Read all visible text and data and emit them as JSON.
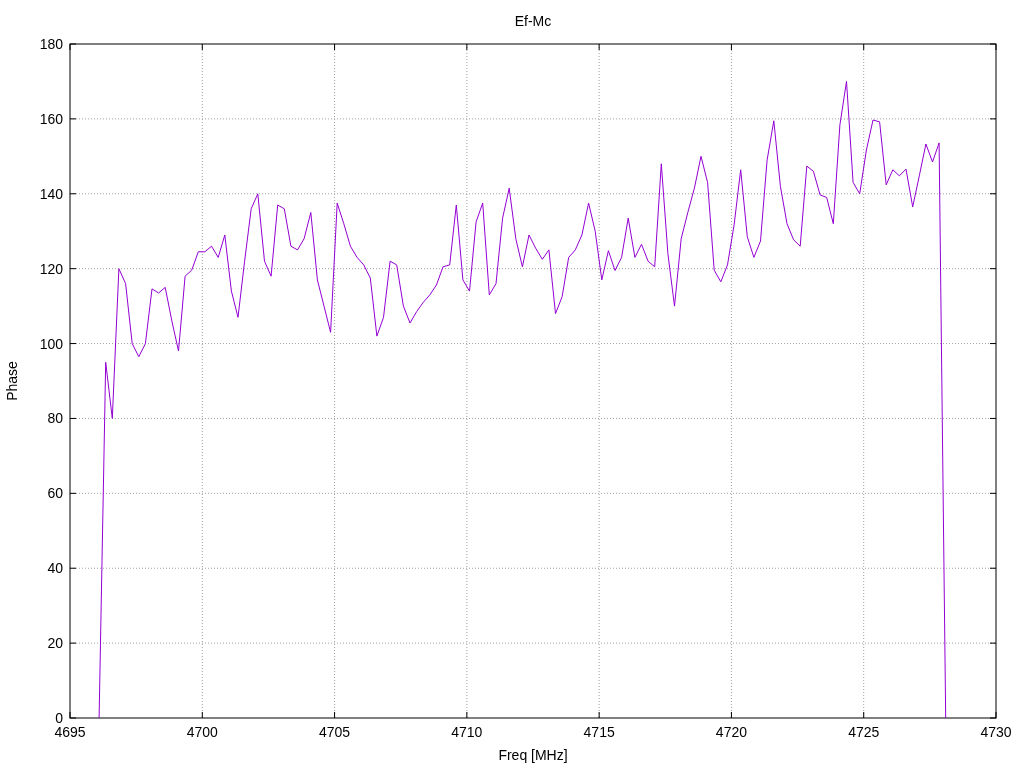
{
  "chart_data": {
    "type": "line",
    "title": "Ef-Mc",
    "xlabel": "Freq [MHz]",
    "ylabel": "Phase",
    "grid": true,
    "xlim": [
      4695,
      4730
    ],
    "ylim": [
      0,
      180
    ],
    "xticks": [
      4695,
      4700,
      4705,
      4710,
      4715,
      4720,
      4725,
      4730
    ],
    "yticks": [
      0,
      20,
      40,
      60,
      80,
      100,
      120,
      140,
      160,
      180
    ],
    "x": [
      4696.1,
      4696.35,
      4696.6,
      4696.85,
      4697.1,
      4697.35,
      4697.6,
      4697.85,
      4698.1,
      4698.35,
      4698.6,
      4698.85,
      4699.1,
      4699.35,
      4699.6,
      4699.85,
      4700.1,
      4700.35,
      4700.6,
      4700.85,
      4701.1,
      4701.35,
      4701.6,
      4701.85,
      4702.1,
      4702.35,
      4702.6,
      4702.85,
      4703.1,
      4703.35,
      4703.6,
      4703.85,
      4704.1,
      4704.35,
      4704.6,
      4704.85,
      4705.1,
      4705.35,
      4705.6,
      4705.85,
      4706.1,
      4706.35,
      4706.6,
      4706.85,
      4707.1,
      4707.35,
      4707.6,
      4707.85,
      4708.1,
      4708.35,
      4708.6,
      4708.85,
      4709.1,
      4709.35,
      4709.6,
      4709.85,
      4710.1,
      4710.35,
      4710.6,
      4710.85,
      4711.1,
      4711.35,
      4711.6,
      4711.85,
      4712.1,
      4712.35,
      4712.6,
      4712.85,
      4713.1,
      4713.35,
      4713.6,
      4713.85,
      4714.1,
      4714.35,
      4714.6,
      4714.85,
      4715.1,
      4715.35,
      4715.6,
      4715.85,
      4716.1,
      4716.35,
      4716.6,
      4716.85,
      4717.1,
      4717.35,
      4717.6,
      4717.85,
      4718.1,
      4718.35,
      4718.6,
      4718.85,
      4719.1,
      4719.35,
      4719.6,
      4719.85,
      4720.1,
      4720.35,
      4720.6,
      4720.85,
      4721.1,
      4721.35,
      4721.6,
      4721.85,
      4722.1,
      4722.35,
      4722.6,
      4722.85,
      4723.1,
      4723.35,
      4723.6,
      4723.85,
      4724.1,
      4724.35,
      4724.6,
      4724.85,
      4725.1,
      4725.35,
      4725.6,
      4725.85,
      4726.1,
      4726.35,
      4726.6,
      4726.85,
      4727.1,
      4727.35,
      4727.6,
      4727.85,
      4728.1
    ],
    "series": [
      {
        "color": "#9400d3",
        "values": [
          0,
          95,
          80,
          120,
          116,
          100,
          96.5,
          100,
          114.6,
          113.5,
          115,
          106,
          98,
          118,
          119.6,
          124.5,
          124.5,
          126,
          123,
          129,
          114,
          107,
          122,
          136,
          140,
          122,
          118,
          137,
          136,
          126,
          125,
          128,
          135,
          117,
          110,
          103,
          137.5,
          132,
          126,
          123,
          121,
          117.5,
          102,
          107,
          122,
          121,
          110,
          105.5,
          108.5,
          111,
          113,
          115.6,
          120.5,
          121,
          137,
          117,
          114,
          132.5,
          137.5,
          113,
          116,
          133.5,
          141.5,
          128,
          120.5,
          129,
          125.5,
          122.5,
          125,
          108,
          112.5,
          123,
          125,
          129,
          137.5,
          130,
          117,
          124.8,
          119.5,
          123,
          133.5,
          123,
          126.5,
          122,
          120.5,
          148,
          124,
          110,
          128,
          135,
          141.5,
          150,
          143,
          119.6,
          116.5,
          121,
          131.7,
          146.4,
          128.5,
          123,
          127.4,
          149,
          159.5,
          142,
          132,
          127.7,
          126,
          147.4,
          146,
          139.7,
          139,
          132,
          158.4,
          170,
          143,
          140,
          151.7,
          159.7,
          159.2,
          142.4,
          146.4,
          144.8,
          146.6,
          136.5,
          144.8,
          153.3,
          148.5,
          153.6,
          0
        ]
      }
    ]
  }
}
